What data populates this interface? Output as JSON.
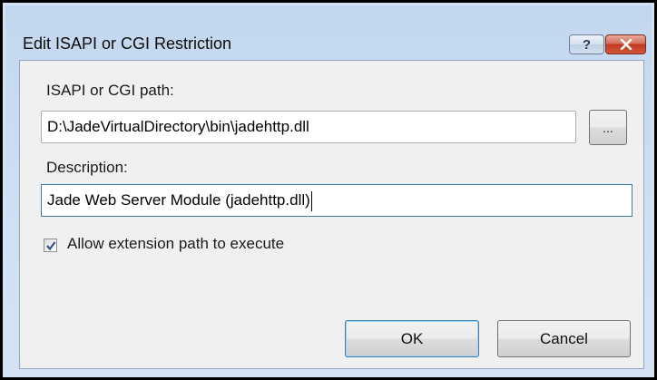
{
  "dialog": {
    "title": "Edit ISAPI or CGI Restriction",
    "help_glyph": "?",
    "path_label": "ISAPI or CGI path:",
    "path_value": "D:\\JadeVirtualDirectory\\bin\\jadehttp.dll",
    "browse_label": "...",
    "description_label": "Description:",
    "description_value": "Jade Web Server Module (jadehttp.dll)",
    "allow_label": "Allow extension path to execute",
    "allow_checked": true,
    "ok_label": "OK",
    "cancel_label": "Cancel"
  },
  "colors": {
    "close_button": "#c1391f",
    "focus_border": "#3d7bad",
    "client_background": "#f0f0f0"
  }
}
